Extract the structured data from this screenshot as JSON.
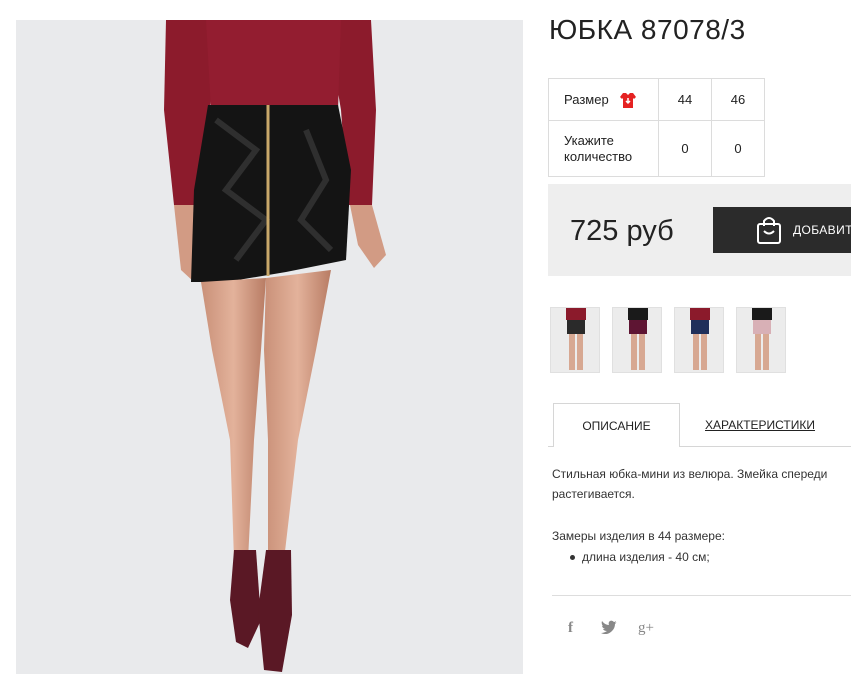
{
  "product": {
    "title": "ЮБКА 87078/3"
  },
  "sizes": {
    "size_label": "Размер",
    "qty_label": "Укажите количество",
    "columns": [
      "44",
      "46"
    ],
    "quantities": [
      "0",
      "0"
    ],
    "icon": "size-chart-icon",
    "icon_color": "#e52222"
  },
  "purchase": {
    "price": "725 руб",
    "add_button_label": "ДОБАВИТЬ",
    "button_icon": "shopping-bag-icon"
  },
  "thumbnails": [
    {
      "skirt_color": "#2a2a2a",
      "top_color": "#8b1a2b"
    },
    {
      "skirt_color": "#5e1533",
      "top_color": "#1a1a1a"
    },
    {
      "skirt_color": "#1f2f5a",
      "top_color": "#8b1a2b"
    },
    {
      "skirt_color": "#d8b0b6",
      "top_color": "#1a1a1a"
    }
  ],
  "tabs": {
    "description": "ОПИСАНИЕ",
    "characteristics": "ХАРАКТЕРИСТИКИ"
  },
  "description": {
    "text": "Стильная юбка-мини из велюра. Змейка спереди растегивается.",
    "measurements_title": "Замеры изделия в 44 размере:",
    "measurements": [
      "длина изделия - 40 см;"
    ]
  },
  "social": {
    "facebook": "f",
    "twitter": "twitter-icon",
    "google_plus": "g+"
  }
}
